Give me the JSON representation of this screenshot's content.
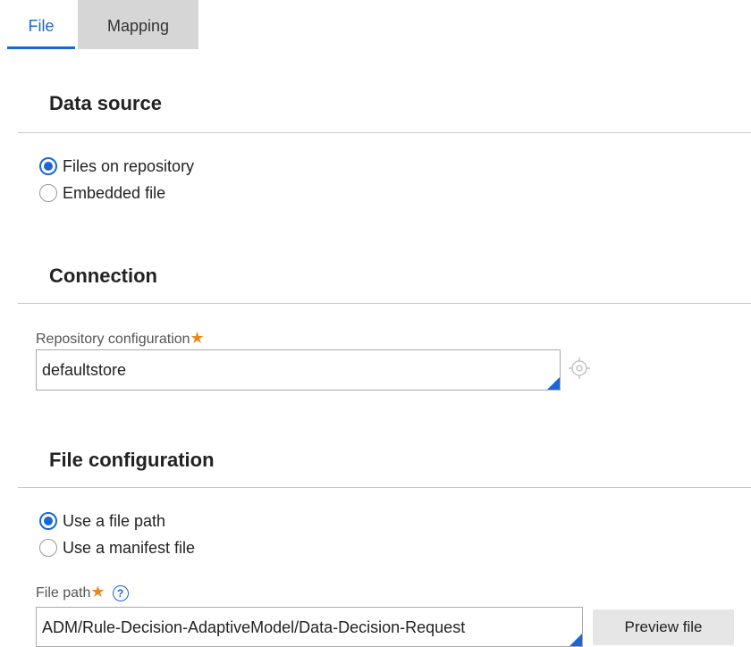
{
  "tabs": [
    {
      "label": "File",
      "active": true
    },
    {
      "label": "Mapping",
      "active": false
    }
  ],
  "data_source": {
    "title": "Data source",
    "options": [
      {
        "label": "Files on repository",
        "checked": true
      },
      {
        "label": "Embedded file",
        "checked": false
      }
    ]
  },
  "connection": {
    "title": "Connection",
    "repository_label": "Repository configuration",
    "required_mark": "★",
    "repository_value": "defaultstore",
    "target_icon": "target-icon"
  },
  "file_configuration": {
    "title": "File configuration",
    "options": [
      {
        "label": "Use a file path",
        "checked": true
      },
      {
        "label": "Use a manifest file",
        "checked": false
      }
    ],
    "file_path_label": "File path",
    "required_mark": "★",
    "help_icon": "?",
    "file_path_value": "ADM/Rule-Decision-AdaptiveModel/Data-Decision-Request",
    "preview_button": "Preview file"
  },
  "colors": {
    "accent": "#1a66d4",
    "required": "#e58a1f",
    "inactive_tab": "#d6d6d6"
  }
}
